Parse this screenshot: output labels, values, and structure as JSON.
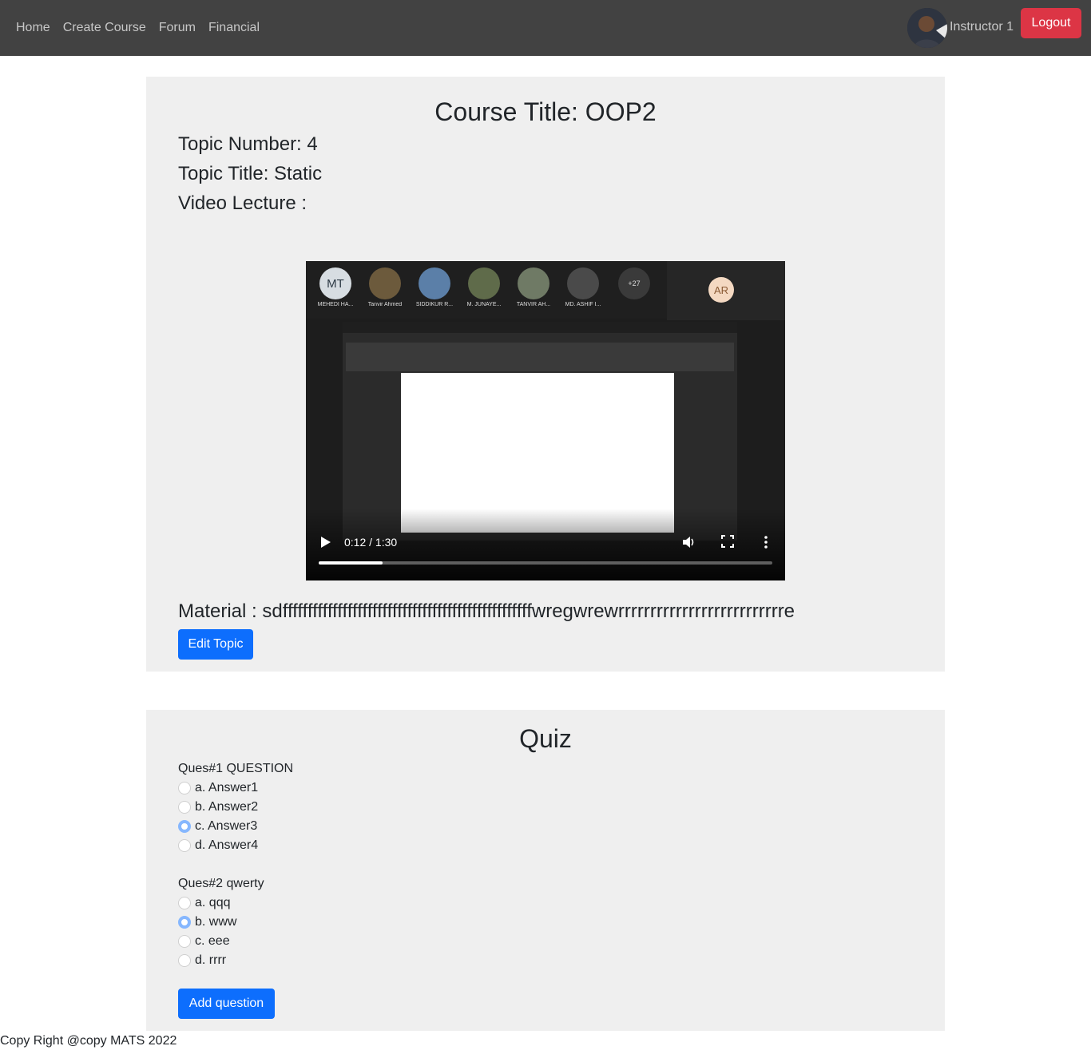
{
  "nav": {
    "links": [
      "Home",
      "Create Course",
      "Forum",
      "Financial"
    ],
    "user_name": "Instructor 1",
    "logout_label": "Logout"
  },
  "topic": {
    "course_title": "Course Title: OOP2",
    "topic_number": "Topic Number: 4",
    "topic_title": "Topic Title: Static",
    "video_label": "Video Lecture :",
    "material": "Material : sdffffffffffffffffffffffffffffffffffffffffffffffffffwregwrewrrrrrrrrrrrrrrrrrrrrrrrrrre",
    "edit_label": "Edit Topic"
  },
  "video": {
    "time": "0:12 / 1:30",
    "progress": 0.14,
    "participants": [
      {
        "initials": "MT",
        "name": "MEHEDI HA..."
      },
      {
        "initials": "",
        "name": "Tanvir Ahmed"
      },
      {
        "initials": "",
        "name": "SIDDIKUR R..."
      },
      {
        "initials": "",
        "name": "M. JUNAYE..."
      },
      {
        "initials": "",
        "name": "TANVIR AH..."
      },
      {
        "initials": "",
        "name": "MD. ASHIF I..."
      },
      {
        "initials": "+27",
        "name": ""
      }
    ],
    "side_initials": "AR"
  },
  "quiz": {
    "title": "Quiz",
    "questions": [
      {
        "text": "Ques#1 QUESTION",
        "options": [
          "a. Answer1",
          "b. Answer2",
          "c. Answer3",
          "d. Answer4"
        ],
        "selected": 2
      },
      {
        "text": "Ques#2 qwerty",
        "options": [
          "a. qqq",
          "b. www",
          "c. eee",
          "d. rrrr"
        ],
        "selected": 1
      }
    ],
    "add_label": "Add question"
  },
  "footer": {
    "text": "Copy Right @copy MATS 2022"
  },
  "colors": {
    "navbar": "#424242",
    "danger": "#dc3545",
    "primary": "#0d6efd",
    "card": "#efefef"
  }
}
